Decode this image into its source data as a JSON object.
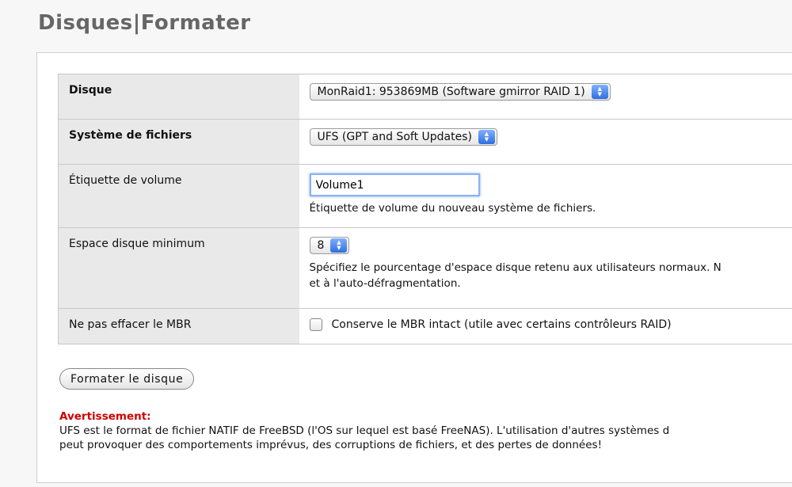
{
  "page": {
    "title": "Disques|Formater"
  },
  "form": {
    "disk": {
      "label": "Disque",
      "selected": "MonRaid1: 953869MB (Software gmirror RAID 1)"
    },
    "filesystem": {
      "label": "Système de fichiers",
      "selected": "UFS (GPT and Soft Updates)"
    },
    "volume_label": {
      "label": "Étiquette de volume",
      "value": "Volume1",
      "hint": "Étiquette de volume du nouveau système de fichiers."
    },
    "min_space": {
      "label": "Espace disque minimum",
      "selected": "8",
      "hint_line1": "Spécifiez le pourcentage d'espace disque retenu aux utilisateurs normaux. N",
      "hint_line2": "et à l'auto-défragmentation."
    },
    "keep_mbr": {
      "label": "Ne pas effacer le MBR",
      "checkbox_label": "Conserve le MBR intact (utile avec certains contrôleurs RAID)",
      "checked": false
    }
  },
  "actions": {
    "format_label": "Formater le disque"
  },
  "warning": {
    "title": "Avertissement:",
    "line1": "UFS est le format de fichier NATIF de FreeBSD (l'OS sur lequel est basé FreeNAS). L'utilisation d'autres systèmes d",
    "line2": "peut provoquer des comportements imprévus, des corruptions de fichiers, et des pertes de données!"
  },
  "colors": {
    "warning_title": "#d00000",
    "label_bg": "#e9e9e9",
    "title_gray": "#666666"
  }
}
